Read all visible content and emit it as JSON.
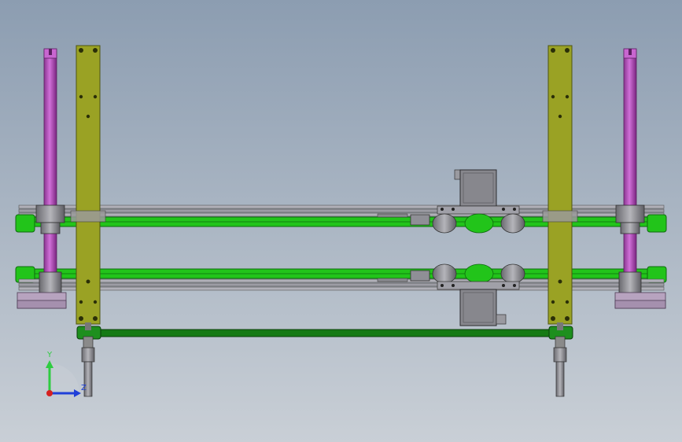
{
  "view": {
    "background_top": "#8c9db1",
    "background_bottom": "#c9cfd6"
  },
  "colors": {
    "plate": "#9aa224",
    "plate_edge": "#4e5410",
    "guide_rod": "#c054c8",
    "guide_rod_dark": "#7e2786",
    "belt": "#22c41a",
    "belt_dark": "#0e6a0e",
    "drive_belt": "#157a14",
    "rail": "#a8a8b0",
    "block": "#8f8f96",
    "bearing_mount": "#b7a3bf",
    "motor": "#87878d",
    "shaft": "#9a9a9a"
  },
  "triad": {
    "y_label": "Y",
    "z_label": "Z",
    "y_color": "#2ecc40",
    "z_color": "#1f3fd8",
    "origin_color": "#d62020"
  }
}
